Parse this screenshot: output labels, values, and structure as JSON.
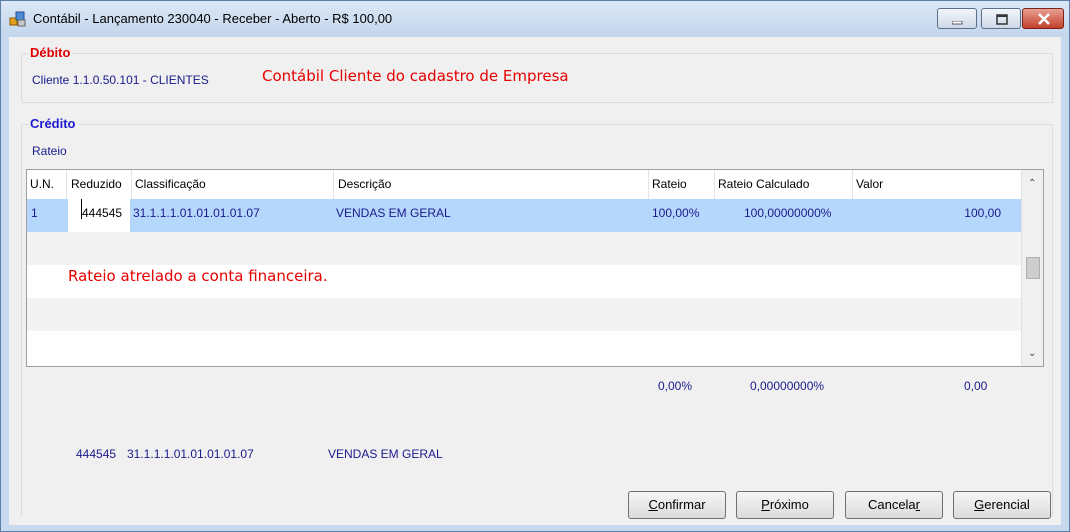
{
  "window": {
    "title": "Contábil - Lançamento 230040 - Receber - Aberto - R$ 100,00",
    "controls": [
      "minimize-icon",
      "maximize-icon",
      "close-icon"
    ]
  },
  "debit": {
    "legend": "Débito",
    "account": "Cliente 1.1.0.50.101 - CLIENTES",
    "annotation": "Contábil Cliente do cadastro de Empresa"
  },
  "credit": {
    "legend": "Crédito",
    "rateio_label": "Rateio",
    "annotation": "Rateio atrelado a conta financeira.",
    "grid": {
      "columns": [
        "U.N.",
        "Reduzido",
        "Classificação",
        "Descrição",
        "Rateio",
        "Rateio Calculado",
        "Valor"
      ],
      "rows": [
        {
          "un": "1",
          "reduzido": "444545",
          "classificacao": "31.1.1.1.01.01.01.01.07",
          "descricao": "VENDAS EM GERAL",
          "rateio": "100,00%",
          "rateio_calculado": "100,00000000%",
          "valor": "100,00"
        }
      ]
    },
    "totals": {
      "rateio": "0,00%",
      "rateio_calculado": "0,00000000%",
      "valor": "0,00"
    },
    "footer": {
      "reduzido": "444545",
      "classificacao": "31.1.1.1.01.01.01.01.07",
      "descricao": "VENDAS EM GERAL"
    }
  },
  "buttons": {
    "confirm": {
      "pre": "",
      "key": "C",
      "post": "onfirmar"
    },
    "next": {
      "pre": "",
      "key": "P",
      "post": "róximo"
    },
    "cancel": {
      "pre": "Cancela",
      "key": "r",
      "post": ""
    },
    "manage": {
      "pre": "",
      "key": "G",
      "post": "erencial"
    }
  },
  "colors": {
    "annotation": "#e60000",
    "debit_legend": "#e00000",
    "credit_legend": "#1a1ad0",
    "text_value": "#1a1a8c",
    "selection": "#b6d7fc"
  }
}
